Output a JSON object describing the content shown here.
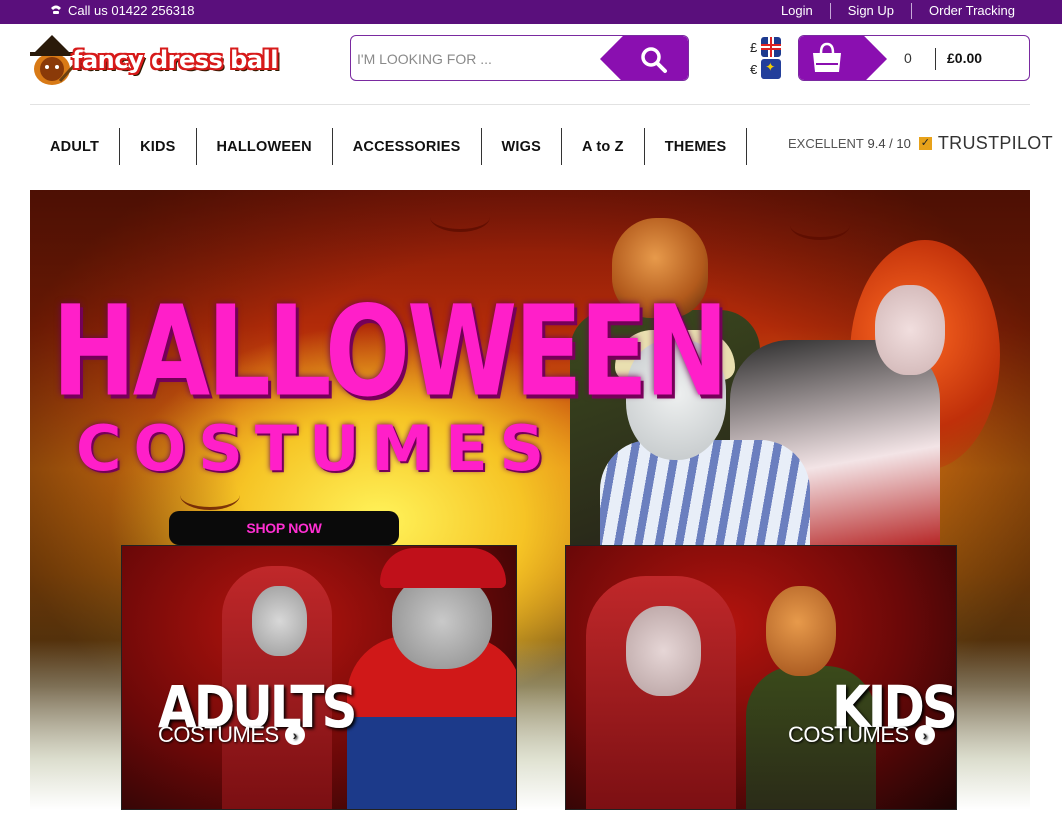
{
  "topbar": {
    "phone": "Call us 01422 256318",
    "links": [
      "Login",
      "Sign Up",
      "Order Tracking"
    ]
  },
  "header": {
    "logo_text": "fancy dress ball",
    "search_placeholder": "I'M LOOKING FOR ...",
    "currency": [
      {
        "symbol": "£",
        "flag": "uk-flag-icon"
      },
      {
        "symbol": "€",
        "flag": "eu-flag-icon"
      }
    ],
    "cart": {
      "count": "0",
      "total": "£0.00"
    }
  },
  "nav": {
    "items": [
      "ADULT",
      "KIDS",
      "HALLOWEEN",
      "ACCESSORIES",
      "WIGS",
      "A to Z",
      "THEMES"
    ]
  },
  "trustpilot": {
    "rating_label": "EXCELLENT",
    "score": "9.4 / 10",
    "brand_a": "TRUST",
    "brand_b": "PILOT"
  },
  "hero": {
    "title": "HALLOWEEN",
    "subtitle": "COSTUMES",
    "cta": "SHOP NOW"
  },
  "cards": [
    {
      "big": "ADULTS",
      "small": "COSTUMES"
    },
    {
      "big": "KIDS",
      "small": "COSTUMES"
    }
  ],
  "colors": {
    "brand_purple": "#5a0f7c",
    "button_purple": "#8a0fb0",
    "hero_pink": "#ff1fc9"
  }
}
